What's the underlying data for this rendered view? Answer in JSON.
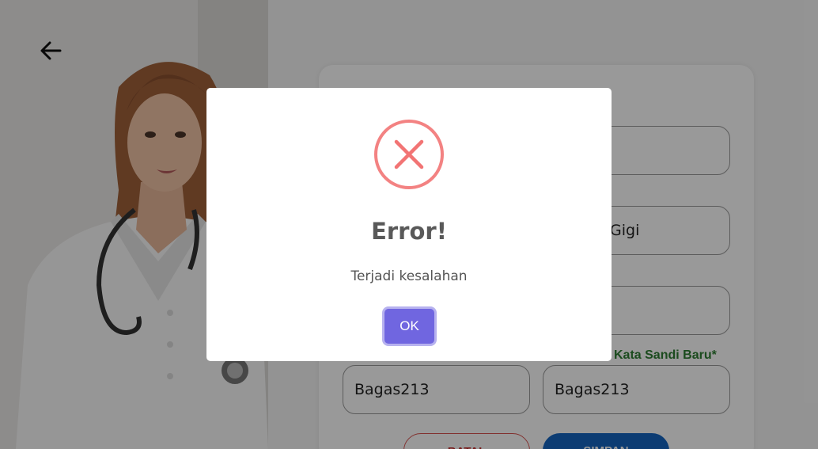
{
  "page": {
    "back_icon": "arrow-left-icon",
    "photo": "doctor-portrait"
  },
  "form": {
    "field_top": "",
    "field_specialty_value": "Gigi",
    "field_third": "",
    "new_password_label": "Kata Sandi Baru*",
    "password_value": "Bagas213",
    "confirm_password_value": "Bagas213",
    "reset_label": "BATAL",
    "save_label": "SIMPAN"
  },
  "dialog": {
    "icon": "error-x-icon",
    "title": "Error!",
    "message": "Terjadi kesalahan",
    "ok_label": "OK",
    "colors": {
      "icon": "#f27474",
      "ok_button": "#7066e0"
    }
  }
}
